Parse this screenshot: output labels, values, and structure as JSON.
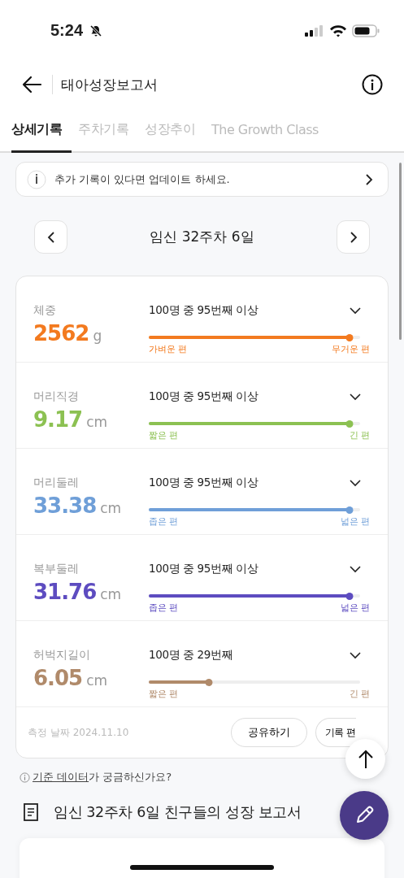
{
  "status_bar": {
    "time": "5:24"
  },
  "header": {
    "title": "태아성장보고서"
  },
  "tabs": [
    {
      "label": "상세기록",
      "selected": true
    },
    {
      "label": "주차기록",
      "selected": false
    },
    {
      "label": "성장추이",
      "selected": false
    },
    {
      "label": "The Growth Class",
      "selected": false
    }
  ],
  "banner": {
    "text": "추가 기록이 있다면 업데이트 하세요."
  },
  "date_nav": {
    "label": "임신 32주차 6일"
  },
  "measurements": [
    {
      "name": "체중",
      "value": "2562",
      "unit": "g",
      "color": "#f37a1f",
      "rank": "100명 중 95번째 이상",
      "level": 0.95,
      "low_label": "가벼운 편",
      "high_label": "무거운 편"
    },
    {
      "name": "머리직경",
      "value": "9.17",
      "unit": "cm",
      "color": "#8cc152",
      "rank": "100명 중 95번째 이상",
      "level": 0.95,
      "low_label": "짧은 편",
      "high_label": "긴 편"
    },
    {
      "name": "머리둘레",
      "value": "33.38",
      "unit": "cm",
      "color": "#6f9fd8",
      "rank": "100명 중 95번째 이상",
      "level": 0.95,
      "low_label": "좁은 편",
      "high_label": "넓은 편"
    },
    {
      "name": "복부둘레",
      "value": "31.76",
      "unit": "cm",
      "color": "#5d4cc0",
      "rank": "100명 중 95번째 이상",
      "level": 0.95,
      "low_label": "좁은 편",
      "high_label": "넓은 편"
    },
    {
      "name": "허벅지길이",
      "value": "6.05",
      "unit": "cm",
      "color": "#b08a6a",
      "rank": "100명 중 29번째",
      "level": 0.285,
      "low_label": "짧은 편",
      "high_label": "긴 편"
    }
  ],
  "card_footer": {
    "date": "측정 날짜 2024.11.10",
    "buttons": [
      "공유하기",
      "기록 편"
    ]
  },
  "help": {
    "link": "기준 데이터",
    "rest": "가 궁금하신가요?"
  },
  "report": {
    "title": "임신 32주차 6일 친구들의 성장 보고서"
  }
}
